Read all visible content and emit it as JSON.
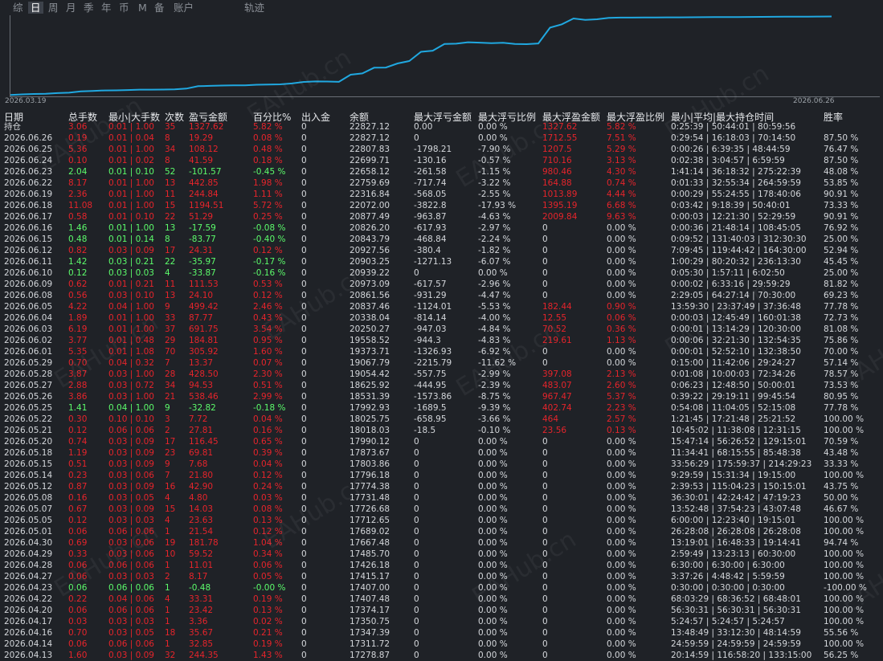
{
  "tabs": [
    {
      "label": "综",
      "active": false
    },
    {
      "label": "日",
      "active": true
    },
    {
      "label": "周",
      "active": false
    },
    {
      "label": "月",
      "active": false
    },
    {
      "label": "季",
      "active": false
    },
    {
      "label": "年",
      "active": false
    },
    {
      "label": "币",
      "active": false
    },
    {
      "label": "M",
      "active": false
    },
    {
      "label": "备",
      "active": false
    },
    {
      "label": "账户",
      "active": false
    },
    {
      "label": "轨迹",
      "active": false
    }
  ],
  "watermark": "EAHub.cn",
  "chart_data": {
    "type": "line",
    "x_start": "2026.03.19",
    "x_end": "2026.06.26",
    "line_color": "#20a8e0",
    "x": [
      0,
      1,
      2,
      3,
      4,
      5,
      6,
      7,
      8,
      9,
      10,
      11,
      12,
      13,
      14,
      15,
      16,
      17,
      18,
      19,
      20,
      21,
      22,
      23,
      24,
      25,
      26,
      27,
      28,
      29,
      30,
      31,
      32,
      33,
      34,
      35,
      36,
      37,
      38,
      39,
      40,
      41,
      42,
      43,
      44,
      45,
      46,
      47,
      48,
      49,
      50,
      51,
      52,
      53,
      54,
      55,
      56,
      57,
      58,
      59,
      60,
      61,
      62,
      63,
      64,
      65,
      66,
      67,
      68,
      69,
      70
    ],
    "values": [
      17000,
      17050,
      17080,
      17100,
      17150,
      17180,
      17278.87,
      17311.72,
      17347.39,
      17350.75,
      17374.17,
      17407.48,
      17407,
      17415.17,
      17426.18,
      17485.7,
      17667.48,
      17689.02,
      17712.65,
      17726.68,
      17731.48,
      17774.38,
      17796.18,
      17803.86,
      17873.67,
      17990.12,
      18025.75,
      18018.03,
      17992.93,
      18531.39,
      18625.92,
      19054.42,
      19067.79,
      19373.71,
      19558.52,
      20250.27,
      20338.04,
      20837.46,
      20861.56,
      20973.09,
      20939.22,
      20903.25,
      20927.56,
      20843.79,
      20826.2,
      20877.49,
      22072,
      22316.84,
      22759.69,
      22658.12,
      22699.71,
      22807.83,
      22827.12,
      22827.12,
      22830,
      22835,
      22840,
      22845,
      22850,
      22855,
      22860,
      22865,
      22870,
      22875,
      22880,
      22885,
      22890,
      22895,
      22900,
      22905,
      22910
    ],
    "ylim": [
      16900,
      23000
    ]
  },
  "columns": [
    "日期",
    "总手数",
    "最小|大手数",
    "次数",
    "盈亏金额",
    "百分比%",
    "出入金",
    "余额",
    "最大浮亏金额",
    "最大浮亏比例",
    "最大浮盈金额",
    "最大浮盈比例",
    "最小|平均|最大持仓时间",
    "胜率"
  ],
  "rows": [
    {
      "t": "r",
      "c": [
        "持仓",
        "3.06",
        "0.01 | 1.00",
        "35",
        "1327.62",
        "5.82 %",
        "0",
        "22827.12",
        "0.00",
        "0.00 %",
        "1327.62",
        "5.82 %",
        "0:25:39 | 50:44:01 | 80:59:56",
        ""
      ]
    },
    {
      "t": "r",
      "c": [
        "2026.06.26",
        "0.19",
        "0.01 | 0.04",
        "8",
        "19.29",
        "0.08 %",
        "0",
        "22827.12",
        "0",
        "0.00 %",
        "1712.55",
        "7.51 %",
        "0:29:54 | 16:18:03 | 70:14:50",
        "87.50 %"
      ]
    },
    {
      "t": "r",
      "c": [
        "2026.06.25",
        "5.36",
        "0.01 | 1.00",
        "34",
        "108.12",
        "0.48 %",
        "0",
        "22807.83",
        "-1798.21",
        "-7.90 %",
        "1207.5",
        "5.29 %",
        "0:00:26 | 6:39:35 | 48:44:59",
        "76.47 %"
      ]
    },
    {
      "t": "r",
      "c": [
        "2026.06.24",
        "0.10",
        "0.01 | 0.02",
        "8",
        "41.59",
        "0.18 %",
        "0",
        "22699.71",
        "-130.16",
        "-0.57 %",
        "710.16",
        "3.13 %",
        "0:02:38 | 3:04:57 | 6:59:59",
        "87.50 %"
      ]
    },
    {
      "t": "g",
      "c": [
        "2026.06.23",
        "2.04",
        "0.01 | 0.10",
        "52",
        "-101.57",
        "-0.45 %",
        "0",
        "22658.12",
        "-261.58",
        "-1.15 %",
        "980.46",
        "4.30 %",
        "1:41:14 | 36:18:32 | 275:22:39",
        "48.08 %"
      ]
    },
    {
      "t": "r",
      "c": [
        "2026.06.22",
        "8.17",
        "0.01 | 1.00",
        "13",
        "442.85",
        "1.98 %",
        "0",
        "22759.69",
        "-717.74",
        "-3.22 %",
        "164.88",
        "0.74 %",
        "0:01:33 | 32:55:34 | 264:59:59",
        "53.85 %"
      ]
    },
    {
      "t": "r",
      "c": [
        "2026.06.19",
        "2.36",
        "0.01 | 1.00",
        "11",
        "244.84",
        "1.11 %",
        "0",
        "22316.84",
        "-568.05",
        "-2.55 %",
        "1013.89",
        "4.44 %",
        "0:00:29 | 55:24:55 | 178:40:06",
        "90.91 %"
      ]
    },
    {
      "t": "r",
      "c": [
        "2026.06.18",
        "11.08",
        "0.01 | 1.00",
        "15",
        "1194.51",
        "5.72 %",
        "0",
        "22072.00",
        "-3822.8",
        "-17.93 %",
        "1395.19",
        "6.68 %",
        "0:03:42 | 9:18:39 | 50:40:01",
        "73.33 %"
      ]
    },
    {
      "t": "r",
      "c": [
        "2026.06.17",
        "0.58",
        "0.01 | 0.10",
        "22",
        "51.29",
        "0.25 %",
        "0",
        "20877.49",
        "-963.87",
        "-4.63 %",
        "2009.84",
        "9.63 %",
        "0:00:03 | 12:21:30 | 52:29:59",
        "90.91 %"
      ]
    },
    {
      "t": "g",
      "c": [
        "2026.06.16",
        "1.46",
        "0.01 | 1.00",
        "13",
        "-17.59",
        "-0.08 %",
        "0",
        "20826.20",
        "-617.93",
        "-2.97 %",
        "0",
        "0.00 %",
        "0:00:36 | 21:48:14 | 108:45:05",
        "76.92 %"
      ]
    },
    {
      "t": "g",
      "c": [
        "2026.06.15",
        "0.48",
        "0.01 | 0.14",
        "8",
        "-83.77",
        "-0.40 %",
        "0",
        "20843.79",
        "-468.84",
        "-2.24 %",
        "0",
        "0.00 %",
        "0:09:52 | 131:40:03 | 312:30:30",
        "25.00 %"
      ]
    },
    {
      "t": "r",
      "c": [
        "2026.06.12",
        "0.82",
        "0.03 | 0.09",
        "17",
        "24.31",
        "0.12 %",
        "0",
        "20927.56",
        "-380.4",
        "-1.82 %",
        "0",
        "0.00 %",
        "7:09:45 | 119:44:42 | 164:30:00",
        "52.94 %"
      ]
    },
    {
      "t": "g",
      "c": [
        "2026.06.11",
        "1.42",
        "0.03 | 0.21",
        "22",
        "-35.97",
        "-0.17 %",
        "0",
        "20903.25",
        "-1271.13",
        "-6.07 %",
        "0",
        "0.00 %",
        "1:00:29 | 80:20:32 | 236:13:30",
        "45.45 %"
      ]
    },
    {
      "t": "g",
      "c": [
        "2026.06.10",
        "0.12",
        "0.03 | 0.03",
        "4",
        "-33.87",
        "-0.16 %",
        "0",
        "20939.22",
        "0",
        "0.00 %",
        "0",
        "0.00 %",
        "0:05:30 | 1:57:11 | 6:02:50",
        "25.00 %"
      ]
    },
    {
      "t": "r",
      "c": [
        "2026.06.09",
        "0.62",
        "0.01 | 0.21",
        "11",
        "111.53",
        "0.53 %",
        "0",
        "20973.09",
        "-617.57",
        "-2.96 %",
        "0",
        "0.00 %",
        "0:00:02 | 6:33:16 | 29:59:29",
        "81.82 %"
      ]
    },
    {
      "t": "r",
      "c": [
        "2026.06.08",
        "0.56",
        "0.03 | 0.10",
        "13",
        "24.10",
        "0.12 %",
        "0",
        "20861.56",
        "-931.29",
        "-4.47 %",
        "0",
        "0.00 %",
        "2:29:05 | 64:27:14 | 70:30:00",
        "69.23 %"
      ]
    },
    {
      "t": "r",
      "c": [
        "2026.06.05",
        "4.22",
        "0.04 | 1.00",
        "9",
        "499.42",
        "2.46 %",
        "0",
        "20837.46",
        "-1124.01",
        "-5.53 %",
        "182.44",
        "0.90 %",
        "13:59:30 | 23:37:49 | 37:36:48",
        "77.78 %"
      ]
    },
    {
      "t": "r",
      "c": [
        "2026.06.04",
        "1.89",
        "0.01 | 1.00",
        "33",
        "87.77",
        "0.43 %",
        "0",
        "20338.04",
        "-814.14",
        "-4.00 %",
        "12.55",
        "0.06 %",
        "0:00:03 | 12:45:49 | 160:01:38",
        "72.73 %"
      ]
    },
    {
      "t": "r",
      "c": [
        "2026.06.03",
        "6.19",
        "0.01 | 1.00",
        "37",
        "691.75",
        "3.54 %",
        "0",
        "20250.27",
        "-947.03",
        "-4.84 %",
        "70.52",
        "0.36 %",
        "0:00:01 | 13:14:29 | 120:30:00",
        "81.08 %"
      ]
    },
    {
      "t": "r",
      "c": [
        "2026.06.02",
        "3.77",
        "0.01 | 0.48",
        "29",
        "184.81",
        "0.95 %",
        "0",
        "19558.52",
        "-944.3",
        "-4.83 %",
        "219.61",
        "1.13 %",
        "0:00:06 | 32:21:30 | 132:54:35",
        "75.86 %"
      ]
    },
    {
      "t": "r",
      "c": [
        "2026.06.01",
        "5.35",
        "0.01 | 1.08",
        "70",
        "305.92",
        "1.60 %",
        "0",
        "19373.71",
        "-1326.93",
        "-6.92 %",
        "0",
        "0.00 %",
        "0:00:01 | 52:52:10 | 132:38:50",
        "70.00 %"
      ]
    },
    {
      "t": "r",
      "c": [
        "2026.05.29",
        "0.70",
        "0.04 | 0.32",
        "7",
        "13.37",
        "0.07 %",
        "0",
        "19067.79",
        "-2215.79",
        "-11.62 %",
        "0",
        "0.00 %",
        "0:15:00 | 11:42:06 | 29:24:27",
        "57.14 %"
      ]
    },
    {
      "t": "r",
      "c": [
        "2026.05.28",
        "3.87",
        "0.03 | 1.00",
        "28",
        "428.50",
        "2.30 %",
        "0",
        "19054.42",
        "-557.75",
        "-2.99 %",
        "397.08",
        "2.13 %",
        "0:01:08 | 10:00:03 | 72:34:26",
        "78.57 %"
      ]
    },
    {
      "t": "r",
      "c": [
        "2026.05.27",
        "2.88",
        "0.03 | 0.72",
        "34",
        "94.53",
        "0.51 %",
        "0",
        "18625.92",
        "-444.95",
        "-2.39 %",
        "483.07",
        "2.60 %",
        "0:06:23 | 12:48:50 | 50:00:01",
        "73.53 %"
      ]
    },
    {
      "t": "r",
      "c": [
        "2026.05.26",
        "3.86",
        "0.03 | 1.00",
        "21",
        "538.46",
        "2.99 %",
        "0",
        "18531.39",
        "-1573.86",
        "-8.75 %",
        "967.47",
        "5.37 %",
        "0:39:22 | 29:19:11 | 99:45:54",
        "80.95 %"
      ]
    },
    {
      "t": "g",
      "c": [
        "2026.05.25",
        "1.41",
        "0.04 | 1.00",
        "9",
        "-32.82",
        "-0.18 %",
        "0",
        "17992.93",
        "-1689.5",
        "-9.39 %",
        "402.74",
        "2.23 %",
        "0:54:08 | 11:04:05 | 52:15:08",
        "77.78 %"
      ]
    },
    {
      "t": "r",
      "c": [
        "2026.05.22",
        "0.30",
        "0.10 | 0.10",
        "3",
        "7.72",
        "0.04 %",
        "0",
        "18025.75",
        "-658.95",
        "-3.66 %",
        "464",
        "2.57 %",
        "1:21:45 | 17:21:48 | 25:21:52",
        "100.00 %"
      ]
    },
    {
      "t": "r",
      "c": [
        "2026.05.21",
        "0.12",
        "0.06 | 0.06",
        "2",
        "27.81",
        "0.16 %",
        "0",
        "18018.03",
        "-18.5",
        "-0.10 %",
        "23.56",
        "0.13 %",
        "10:45:02 | 11:38:08 | 12:31:15",
        "100.00 %"
      ]
    },
    {
      "t": "r",
      "c": [
        "2026.05.20",
        "0.74",
        "0.03 | 0.09",
        "17",
        "116.45",
        "0.65 %",
        "0",
        "17990.12",
        "0",
        "0.00 %",
        "0",
        "0.00 %",
        "15:47:14 | 56:26:52 | 129:15:01",
        "70.59 %"
      ]
    },
    {
      "t": "r",
      "c": [
        "2026.05.18",
        "1.19",
        "0.03 | 0.09",
        "23",
        "69.81",
        "0.39 %",
        "0",
        "17873.67",
        "0",
        "0.00 %",
        "0",
        "0.00 %",
        "11:34:41 | 68:15:55 | 85:48:38",
        "43.48 %"
      ]
    },
    {
      "t": "r",
      "c": [
        "2026.05.15",
        "0.51",
        "0.03 | 0.09",
        "9",
        "7.68",
        "0.04 %",
        "0",
        "17803.86",
        "0",
        "0.00 %",
        "0",
        "0.00 %",
        "33:56:29 | 175:59:37 | 214:29:23",
        "33.33 %"
      ]
    },
    {
      "t": "r",
      "c": [
        "2026.05.14",
        "0.23",
        "0.03 | 0.06",
        "7",
        "21.80",
        "0.12 %",
        "0",
        "17796.18",
        "0",
        "0.00 %",
        "0",
        "0.00 %",
        "9:29:59 | 15:31:34 | 19:15:00",
        "100.00 %"
      ]
    },
    {
      "t": "r",
      "c": [
        "2026.05.12",
        "0.87",
        "0.03 | 0.09",
        "16",
        "42.90",
        "0.24 %",
        "0",
        "17774.38",
        "0",
        "0.00 %",
        "0",
        "0.00 %",
        "2:39:53 | 115:04:23 | 150:15:01",
        "43.75 %"
      ]
    },
    {
      "t": "r",
      "c": [
        "2026.05.08",
        "0.16",
        "0.03 | 0.05",
        "4",
        "4.80",
        "0.03 %",
        "0",
        "17731.48",
        "0",
        "0.00 %",
        "0",
        "0.00 %",
        "36:30:01 | 42:24:42 | 47:19:23",
        "50.00 %"
      ]
    },
    {
      "t": "r",
      "c": [
        "2026.05.07",
        "0.67",
        "0.03 | 0.09",
        "15",
        "14.03",
        "0.08 %",
        "0",
        "17726.68",
        "0",
        "0.00 %",
        "0",
        "0.00 %",
        "13:52:48 | 37:54:23 | 43:07:48",
        "46.67 %"
      ]
    },
    {
      "t": "r",
      "c": [
        "2026.05.05",
        "0.12",
        "0.03 | 0.03",
        "4",
        "23.63",
        "0.13 %",
        "0",
        "17712.65",
        "0",
        "0.00 %",
        "0",
        "0.00 %",
        "6:00:00 | 12:23:40 | 19:15:01",
        "100.00 %"
      ]
    },
    {
      "t": "r",
      "c": [
        "2026.05.01",
        "0.06",
        "0.06 | 0.06",
        "1",
        "21.54",
        "0.12 %",
        "0",
        "17689.02",
        "0",
        "0.00 %",
        "0",
        "0.00 %",
        "26:28:08 | 26:28:08 | 26:28:08",
        "100.00 %"
      ]
    },
    {
      "t": "r",
      "c": [
        "2026.04.30",
        "0.69",
        "0.03 | 0.06",
        "19",
        "181.78",
        "1.04 %",
        "0",
        "17667.48",
        "0",
        "0.00 %",
        "0",
        "0.00 %",
        "13:19:01 | 16:48:33 | 19:14:41",
        "94.74 %"
      ]
    },
    {
      "t": "r",
      "c": [
        "2026.04.29",
        "0.33",
        "0.03 | 0.06",
        "10",
        "59.52",
        "0.34 %",
        "0",
        "17485.70",
        "0",
        "0.00 %",
        "0",
        "0.00 %",
        "2:59:49 | 13:23:13 | 60:30:00",
        "100.00 %"
      ]
    },
    {
      "t": "r",
      "c": [
        "2026.04.28",
        "0.06",
        "0.06 | 0.06",
        "1",
        "11.01",
        "0.06 %",
        "0",
        "17426.18",
        "0",
        "0.00 %",
        "0",
        "0.00 %",
        "6:30:00 | 6:30:00 | 6:30:00",
        "100.00 %"
      ]
    },
    {
      "t": "r",
      "c": [
        "2026.04.27",
        "0.06",
        "0.03 | 0.03",
        "2",
        "8.17",
        "0.05 %",
        "0",
        "17415.17",
        "0",
        "0.00 %",
        "0",
        "0.00 %",
        "3:37:26 | 4:48:42 | 5:59:59",
        "100.00 %"
      ]
    },
    {
      "t": "g",
      "c": [
        "2026.04.23",
        "0.06",
        "0.06 | 0.06",
        "1",
        "-0.48",
        "-0.00 %",
        "0",
        "17407.00",
        "0",
        "0.00 %",
        "0",
        "0.00 %",
        "0:30:00 | 0:30:00 | 0:30:00",
        "-100.00 %"
      ]
    },
    {
      "t": "r",
      "c": [
        "2026.04.22",
        "0.22",
        "0.04 | 0.06",
        "4",
        "33.31",
        "0.19 %",
        "0",
        "17407.48",
        "0",
        "0.00 %",
        "0",
        "0.00 %",
        "68:03:29 | 68:36:52 | 68:48:01",
        "100.00 %"
      ]
    },
    {
      "t": "r",
      "c": [
        "2026.04.20",
        "0.06",
        "0.06 | 0.06",
        "1",
        "23.42",
        "0.13 %",
        "0",
        "17374.17",
        "0",
        "0.00 %",
        "0",
        "0.00 %",
        "56:30:31 | 56:30:31 | 56:30:31",
        "100.00 %"
      ]
    },
    {
      "t": "r",
      "c": [
        "2026.04.17",
        "0.03",
        "0.03 | 0.03",
        "1",
        "3.36",
        "0.02 %",
        "0",
        "17350.75",
        "0",
        "0.00 %",
        "0",
        "0.00 %",
        "5:24:57 | 5:24:57 | 5:24:57",
        "100.00 %"
      ]
    },
    {
      "t": "r",
      "c": [
        "2026.04.16",
        "0.70",
        "0.03 | 0.05",
        "18",
        "35.67",
        "0.21 %",
        "0",
        "17347.39",
        "0",
        "0.00 %",
        "0",
        "0.00 %",
        "13:48:49 | 33:12:30 | 48:14:59",
        "55.56 %"
      ]
    },
    {
      "t": "r",
      "c": [
        "2026.04.14",
        "0.06",
        "0.06 | 0.06",
        "1",
        "32.85",
        "0.19 %",
        "0",
        "17311.72",
        "0",
        "0.00 %",
        "0",
        "0.00 %",
        "24:59:59 | 24:59:59 | 24:59:59",
        "100.00 %"
      ]
    },
    {
      "t": "r",
      "c": [
        "2026.04.13",
        "1.60",
        "0.03 | 0.09",
        "32",
        "244.35",
        "1.43 %",
        "0",
        "17278.87",
        "0",
        "0.00 %",
        "0",
        "0.00 %",
        "20:14:59 | 116:58:20 | 133:15:00",
        "56.25 %"
      ]
    }
  ]
}
